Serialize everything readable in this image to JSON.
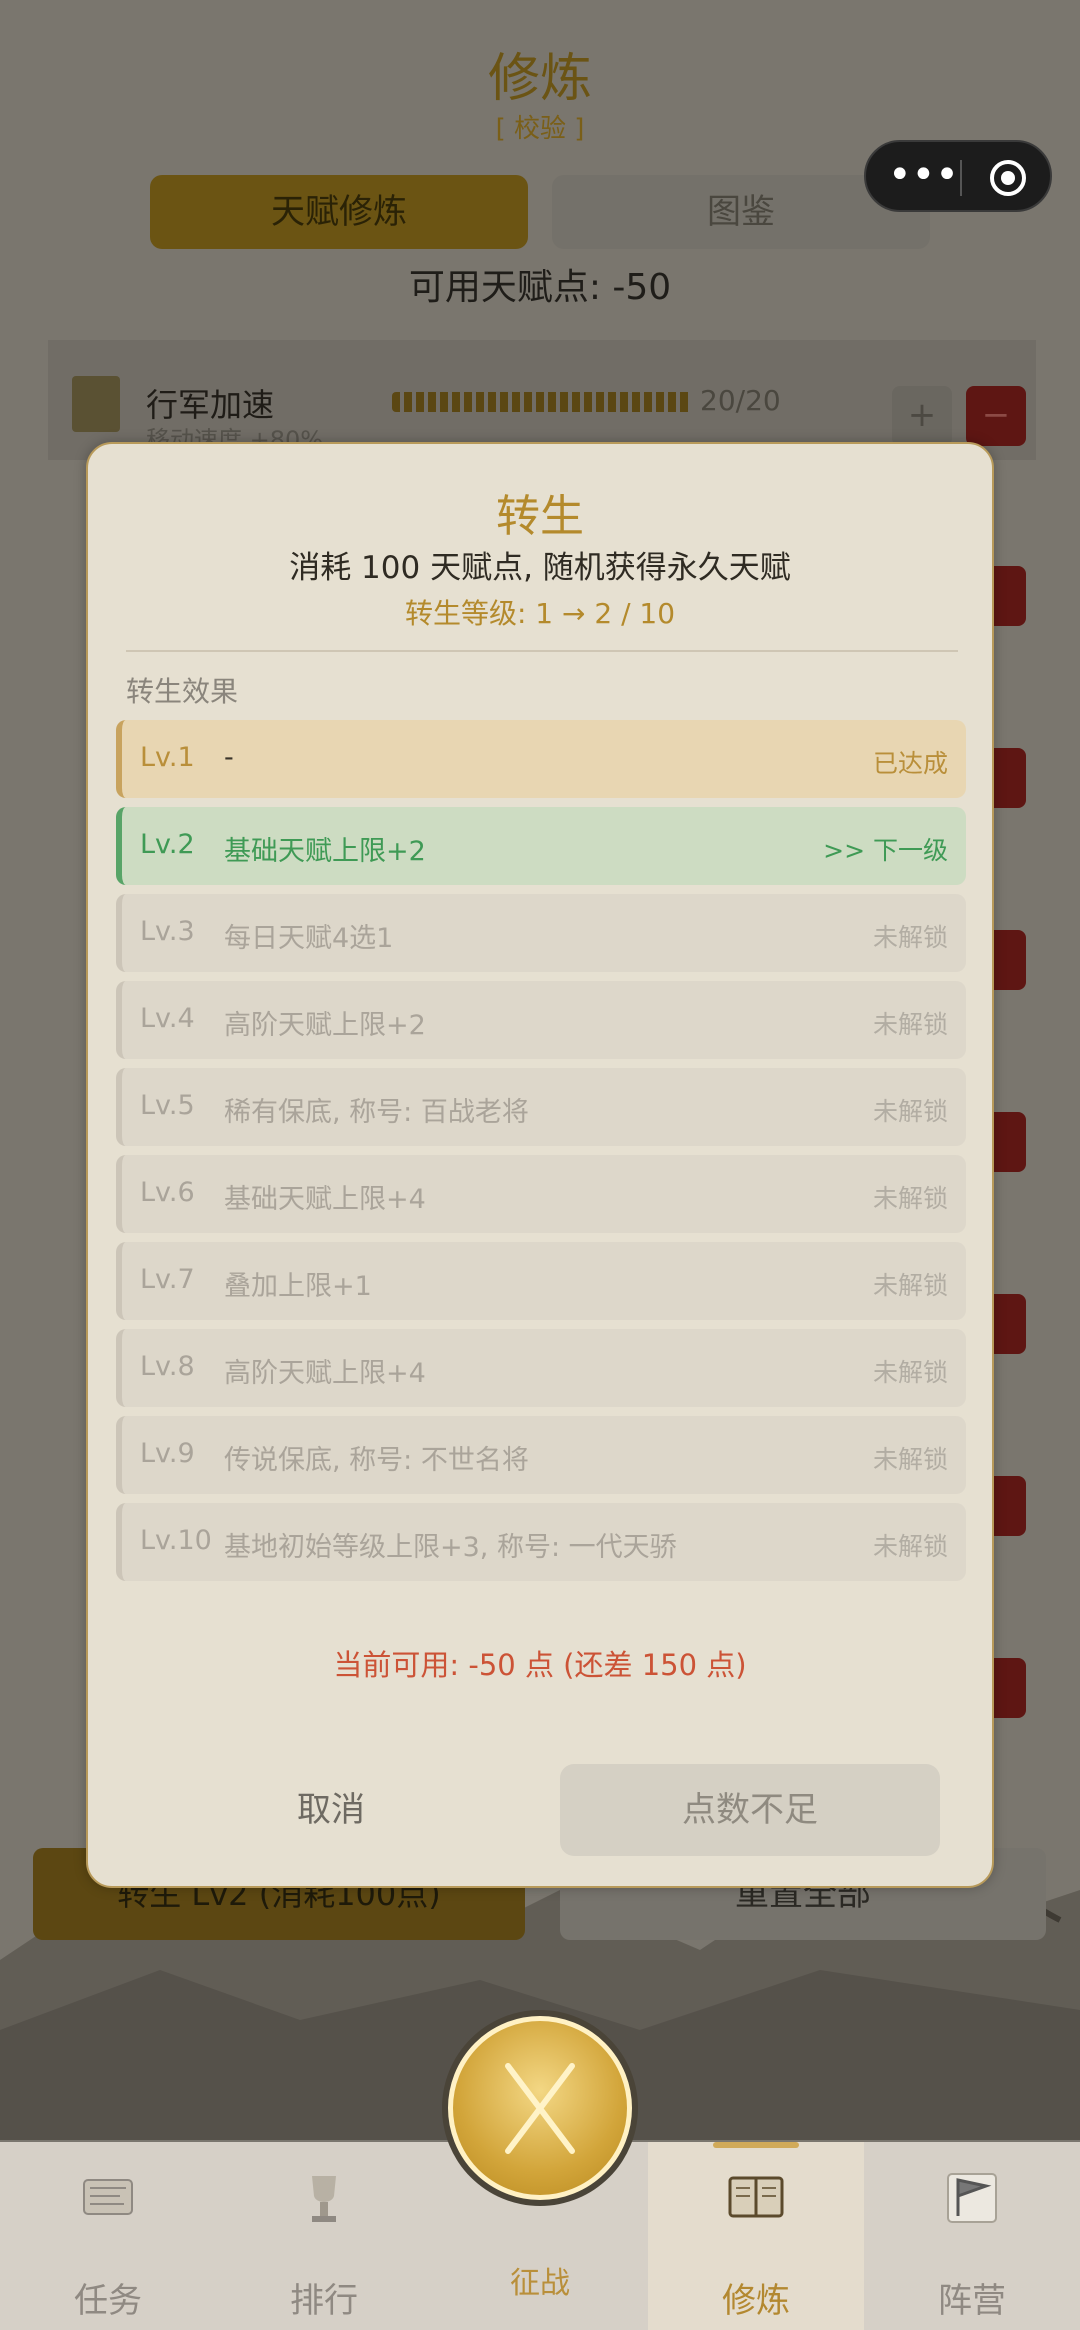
{
  "page": {
    "title": "修炼",
    "subtitle": "[ 校验 ]",
    "tabs": [
      {
        "label": "天赋修炼"
      },
      {
        "label": "图鉴"
      }
    ],
    "available_points": "可用天赋点: -50",
    "talent_row": {
      "name": "行军加速",
      "desc": "移动速度 +80%",
      "count": "20/20",
      "plus": "+",
      "minus": "−"
    },
    "rebirth_button": "转生 Lv2 (消耗100点)",
    "reset_button": "重置全部"
  },
  "modal": {
    "title": "转生",
    "description": "消耗 100 天赋点, 随机获得永久天赋",
    "level_line": "转生等级: 1 → 2 / 10",
    "section_label": "转生效果",
    "levels": [
      {
        "num": "Lv.1",
        "effect": "-",
        "status": "已达成"
      },
      {
        "num": "Lv.2",
        "effect": "基础天赋上限+2",
        "status": ">> 下一级"
      },
      {
        "num": "Lv.3",
        "effect": "每日天赋4选1",
        "status": "未解锁"
      },
      {
        "num": "Lv.4",
        "effect": "高阶天赋上限+2",
        "status": "未解锁"
      },
      {
        "num": "Lv.5",
        "effect": "稀有保底, 称号: 百战老将",
        "status": "未解锁"
      },
      {
        "num": "Lv.6",
        "effect": "基础天赋上限+4",
        "status": "未解锁"
      },
      {
        "num": "Lv.7",
        "effect": "叠加上限+1",
        "status": "未解锁"
      },
      {
        "num": "Lv.8",
        "effect": "高阶天赋上限+4",
        "status": "未解锁"
      },
      {
        "num": "Lv.9",
        "effect": "传说保底, 称号: 不世名将",
        "status": "未解锁"
      },
      {
        "num": "Lv.10",
        "effect": "基地初始等级上限+3, 称号: 一代天骄",
        "status": "未解锁"
      }
    ],
    "available": "当前可用: -50 点 (还差 150 点)",
    "cancel_label": "取消",
    "insufficient_label": "点数不足"
  },
  "tabbar": {
    "items": [
      {
        "label": "任务",
        "icon": "scroll-map-icon"
      },
      {
        "label": "排行",
        "icon": "trophy-icon"
      },
      {
        "label": "征战",
        "icon": "crossed-swords-icon"
      },
      {
        "label": "修炼",
        "icon": "book-icon"
      },
      {
        "label": "阵营",
        "icon": "flag-icon"
      }
    ]
  },
  "capsule": {
    "more_icon": "more-dots-icon",
    "close_icon": "target-circle-icon",
    "dots": "•••"
  },
  "colors": {
    "accent_gold": "#b48a2c",
    "next_green": "#3f9a55",
    "warn_red": "#cc5336"
  }
}
